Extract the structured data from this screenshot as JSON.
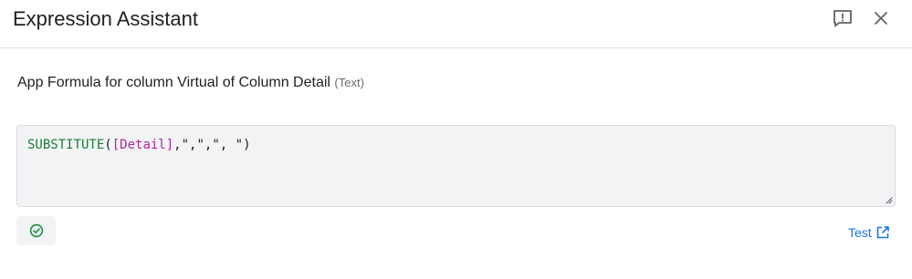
{
  "header": {
    "title": "Expression Assistant",
    "feedback_icon": "feedback-icon",
    "close_icon": "close-icon"
  },
  "field": {
    "description": "App Formula for column Virtual of Column Detail",
    "type": "(Text)"
  },
  "editor": {
    "tokens": {
      "fn": "SUBSTITUTE",
      "open": "(",
      "column": "[Detail]",
      "comma1": ",",
      "arg2": "\",\"",
      "comma2": ",",
      "arg3_open": "\",",
      "arg3_space": " ",
      "arg3_close": "\")"
    }
  },
  "status": {
    "valid_icon": "check-circle-icon"
  },
  "test": {
    "label": "Test",
    "icon": "open-in-new-icon"
  },
  "colors": {
    "function": "#1e7c34",
    "column": "#b3259a",
    "link": "#1a73e8",
    "editor_bg": "#f1f3f4"
  }
}
